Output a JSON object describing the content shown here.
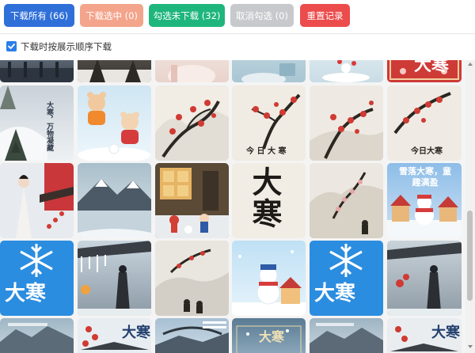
{
  "toolbar": {
    "download_all": "下载所有 (66)",
    "download_selected": "下载选中 (0)",
    "select_undownloaded": "勾选未下载 (32)",
    "deselect": "取消勾选 (0)",
    "reset_record": "重置记录"
  },
  "options": {
    "download_in_order_label": "下载时按展示顺序下载",
    "download_in_order_checked": true
  },
  "colors": {
    "download_all": "#2f6fd8",
    "download_selected": "#f3a48b",
    "select_undownloaded": "#1fb67d",
    "deselect": "#c7c9cc",
    "reset_record": "#ec4c4c",
    "checkbox": "#2b7de9"
  },
  "gallery": {
    "row2": {
      "tile1_text": "大寒，万物凝藏",
      "tile4_text": "今 日 大 寒",
      "tile6_text": "今日大寒"
    },
    "row3": {
      "tile4_text": "大寒",
      "tile6_text": "雪落大寒，童趣满盈"
    },
    "row4": {
      "tile1_text": "大寒"
    },
    "row5": {
      "tile2_text": "大寒",
      "tile4_text": "大寒",
      "tile6_text": "大寒"
    },
    "row1": {
      "tile6_text": "大寒"
    }
  }
}
